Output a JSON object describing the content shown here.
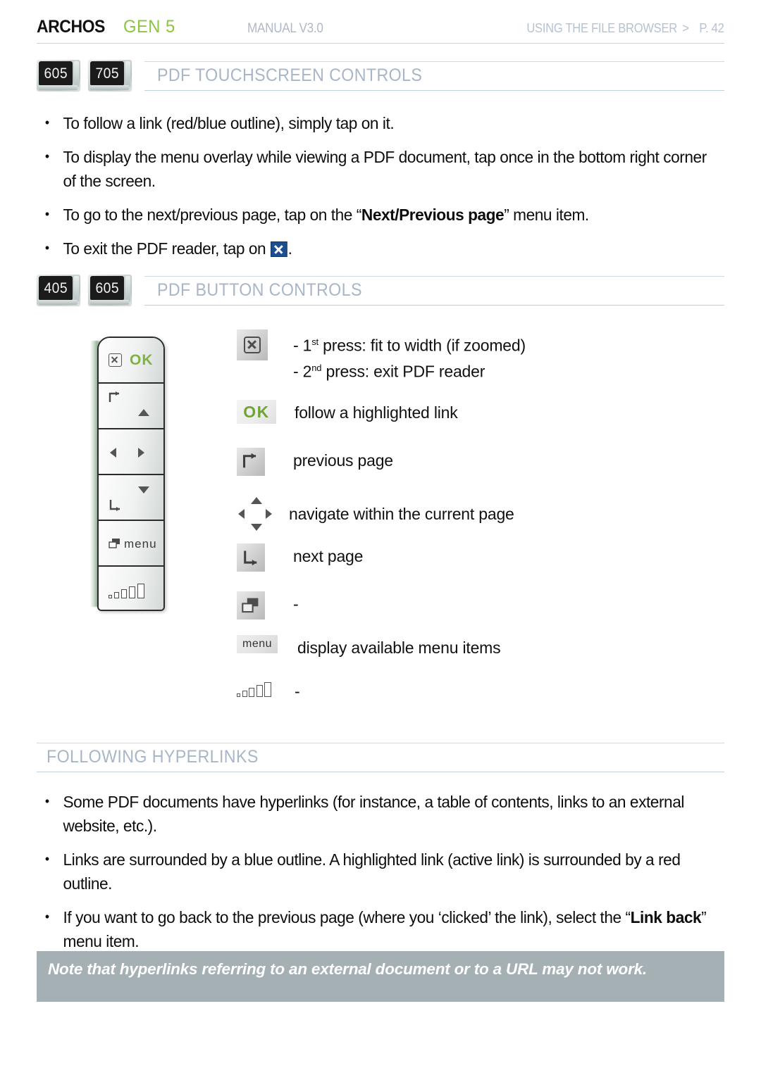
{
  "header": {
    "brand": "ARCHOS",
    "brand_suffix": "GEN 5",
    "manual": "MANUAL V3.0",
    "breadcrumb": "USING THE FILE BROWSER",
    "chevron": ">",
    "page_label": "P. 42",
    "brand_color": "#111111",
    "accent_green": "#8cc63f",
    "muted_blue": "#b0b8c8"
  },
  "sections": {
    "touchscreen": {
      "title": "PDF TOUCHSCREEN CONTROLS",
      "badges": [
        "605",
        "705"
      ],
      "bullets": [
        {
          "parts": [
            {
              "text": "To follow a link (red/blue outline), simply tap on it."
            }
          ]
        },
        {
          "parts": [
            {
              "text": "To display the menu overlay while viewing a PDF document, tap once in the bottom right corner of the screen."
            }
          ]
        },
        {
          "parts": [
            {
              "text": "To go to the next/previous page, tap on the “"
            },
            {
              "text": "Next/Previous page",
              "bold": true
            },
            {
              "text": "” menu item."
            }
          ]
        },
        {
          "parts": [
            {
              "text": "To exit the PDF reader, tap on "
            },
            {
              "icon": "close-x-icon"
            },
            {
              "text": "."
            }
          ]
        }
      ]
    },
    "buttons": {
      "title": "PDF BUTTON CONTROLS",
      "badges": [
        "405",
        "605"
      ],
      "legend": [
        {
          "icon": "close-x-icon",
          "lines": [
            {
              "prefix": "- 1",
              "sup": "st",
              "rest": " press: fit to width (if zoomed)"
            },
            {
              "prefix": "- 2",
              "sup": "nd",
              "rest": " press: exit PDF reader"
            }
          ]
        },
        {
          "icon": "ok-icon",
          "label": "follow a highlighted link"
        },
        {
          "icon": "previous-page-icon",
          "label": "previous page"
        },
        {
          "icon": "navigate-dpad-icon",
          "label": "navigate within the current page"
        },
        {
          "icon": "next-page-icon",
          "label": "next page"
        },
        {
          "icon": "tab-switch-icon",
          "label": "-"
        },
        {
          "icon": "menu-icon",
          "label": "display available menu items"
        },
        {
          "icon": "volume-icon",
          "label": "-"
        }
      ],
      "remote": {
        "keys": [
          {
            "name": "exit-ok-key",
            "glyphs": [
              "close-x-icon",
              "OK"
            ]
          },
          {
            "name": "previous-up-key",
            "glyphs": [
              "previous-page-icon",
              "up-arrow"
            ]
          },
          {
            "name": "left-right-key",
            "glyphs": [
              "left-arrow",
              "right-arrow"
            ]
          },
          {
            "name": "down-next-key",
            "glyphs": [
              "down-arrow",
              "next-page-icon"
            ]
          },
          {
            "name": "menu-key",
            "glyphs": [
              "tab-switch-icon",
              "menu"
            ]
          },
          {
            "name": "volume-key",
            "glyphs": [
              "volume-icon"
            ]
          }
        ],
        "ok_label": "OK",
        "menu_label": "menu"
      }
    },
    "hyperlinks": {
      "title": "FOLLOWING HYPERLINKS",
      "bullets": [
        {
          "parts": [
            {
              "text": "Some PDF documents have hyperlinks (for instance, a table of contents, links to an external website, etc.)."
            }
          ]
        },
        {
          "parts": [
            {
              "text": "Links are surrounded by a blue outline. A highlighted link (active link) is surrounded by a red outline."
            }
          ]
        },
        {
          "parts": [
            {
              "text": "If you want to go back to the previous page (where you ‘clicked’ the link), select the “"
            },
            {
              "text": "Link back",
              "bold": true
            },
            {
              "text": "” menu item."
            }
          ]
        }
      ]
    }
  },
  "note": {
    "text": "Note that hyperlinks referring to an external document or to a URL may not work.",
    "background": "#a4b0b4",
    "text_color": "#ffffff"
  }
}
